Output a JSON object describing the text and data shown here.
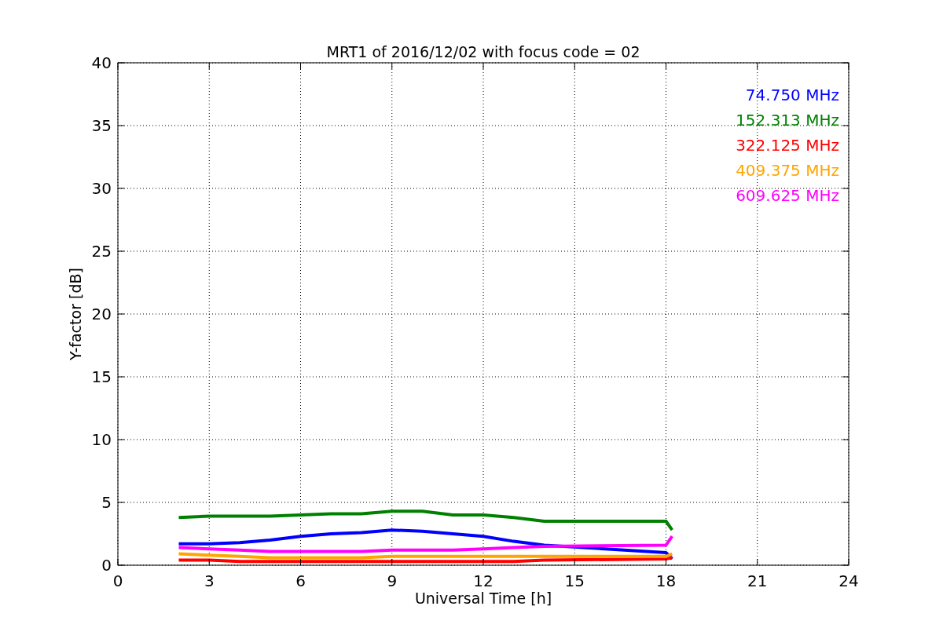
{
  "figure": {
    "chart_data": {
      "type": "line",
      "title": "MRT1 of 2016/12/02 with focus code = 02",
      "xlabel": "Universal Time [h]",
      "ylabel": "Y-factor [dB]",
      "x": [
        2,
        3,
        4,
        5,
        6,
        7,
        8,
        9,
        10,
        11,
        12,
        13,
        14,
        18,
        18.2
      ],
      "series": [
        {
          "name": "74.750 MHz",
          "color": "#0000ff",
          "values": [
            1.7,
            1.7,
            1.8,
            2.0,
            2.3,
            2.5,
            2.6,
            2.8,
            2.7,
            2.5,
            2.3,
            1.9,
            1.6,
            1.0,
            0.5
          ]
        },
        {
          "name": "152.313 MHz",
          "color": "#008000",
          "values": [
            3.8,
            3.9,
            3.9,
            3.9,
            4.0,
            4.1,
            4.1,
            4.3,
            4.3,
            4.0,
            4.0,
            3.8,
            3.5,
            3.5,
            2.8
          ]
        },
        {
          "name": "322.125 MHz",
          "color": "#ff0000",
          "values": [
            0.4,
            0.4,
            0.3,
            0.3,
            0.3,
            0.3,
            0.3,
            0.3,
            0.3,
            0.3,
            0.3,
            0.3,
            0.4,
            0.5,
            0.6
          ]
        },
        {
          "name": "409.375 MHz",
          "color": "#ffa500",
          "values": [
            0.9,
            0.8,
            0.7,
            0.6,
            0.6,
            0.6,
            0.6,
            0.7,
            0.7,
            0.7,
            0.7,
            0.7,
            0.7,
            0.7,
            0.9
          ]
        },
        {
          "name": "609.625 MHz",
          "color": "#ff00ff",
          "values": [
            1.4,
            1.3,
            1.2,
            1.1,
            1.1,
            1.1,
            1.1,
            1.2,
            1.2,
            1.2,
            1.3,
            1.4,
            1.5,
            1.6,
            2.3
          ]
        }
      ],
      "grid": true,
      "xlim": [
        0,
        24
      ],
      "ylim": [
        0,
        40
      ],
      "xticks": [
        0,
        3,
        6,
        9,
        12,
        15,
        18,
        21,
        24
      ],
      "yticks": [
        0,
        5,
        10,
        15,
        20,
        25,
        30,
        35,
        40
      ]
    }
  }
}
